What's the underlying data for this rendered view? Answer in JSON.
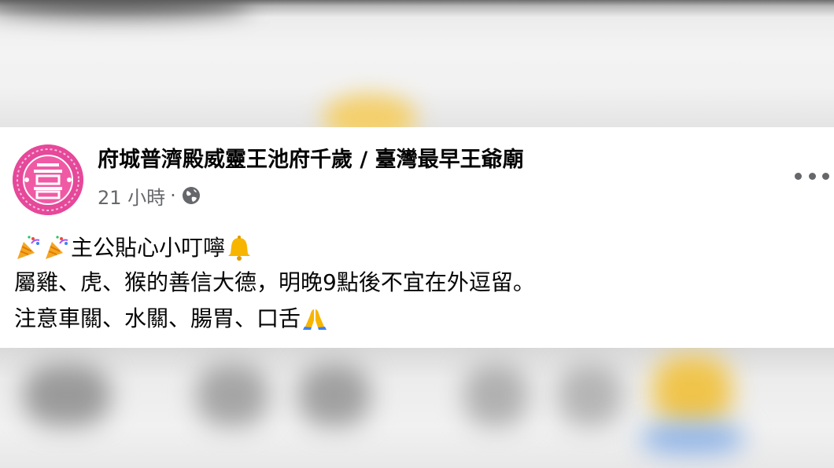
{
  "post": {
    "page_name": "府城普濟殿威靈王池府千歲 / 臺灣最早王爺廟",
    "timestamp": "21 小時",
    "separator": "·",
    "privacy_icon": "globe-icon",
    "more_icon": "more-options-icon",
    "lines": {
      "line1_text": "主公貼心小叮嚀",
      "line1_leading_emojis": [
        "party-popper-icon",
        "party-popper-icon"
      ],
      "line1_trailing_emoji": "bell-icon",
      "line2_text": "屬雞、虎、猴的善信大德，明晚9點後不宜在外逗留。",
      "line3_text": "注意車關、水關、腸胃、口舌",
      "line3_trailing_emoji": "folded-hands-icon"
    }
  },
  "colors": {
    "avatar_pink": "#e6489a",
    "text_primary": "#050505",
    "text_secondary": "#65676b",
    "card_bg": "#ffffff"
  }
}
